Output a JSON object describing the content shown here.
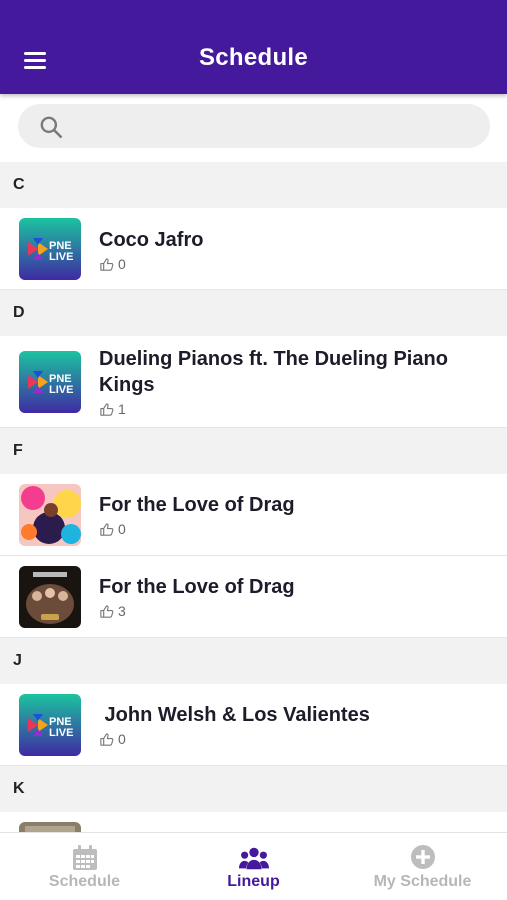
{
  "header": {
    "title": "Schedule",
    "menu_icon": "hamburger-menu-icon"
  },
  "search": {
    "placeholder": "",
    "icon": "search-icon"
  },
  "colors": {
    "brand": "#44199b",
    "section_bg": "#f2f2f2",
    "tab_inactive": "#b7b7b7"
  },
  "sections": [
    {
      "letter": "C",
      "items": [
        {
          "title": "Coco Jafro",
          "likes": "0",
          "thumb": "pne-live-logo"
        }
      ]
    },
    {
      "letter": "D",
      "items": [
        {
          "title": "Dueling Pianos ft. The Dueling Piano Kings",
          "likes": "1",
          "thumb": "pne-live-logo"
        }
      ]
    },
    {
      "letter": "F",
      "items": [
        {
          "title": "For the Love of Drag",
          "likes": "0",
          "thumb": "drag-artwork-colorful"
        },
        {
          "title": "For the Love of Drag",
          "likes": "3",
          "thumb": "drag-artwork-dark"
        }
      ]
    },
    {
      "letter": "J",
      "items": [
        {
          "title": " John Welsh & Los Valientes",
          "likes": "0",
          "thumb": "pne-live-logo"
        }
      ]
    },
    {
      "letter": "K",
      "items": []
    }
  ],
  "logo_text": {
    "line1": "PNE",
    "line2": "LIVE"
  },
  "tabs": [
    {
      "label": "Schedule",
      "icon": "calendar-icon",
      "active": false
    },
    {
      "label": "Lineup",
      "icon": "group-icon",
      "active": true
    },
    {
      "label": "My Schedule",
      "icon": "plus-circle-icon",
      "active": false
    }
  ]
}
